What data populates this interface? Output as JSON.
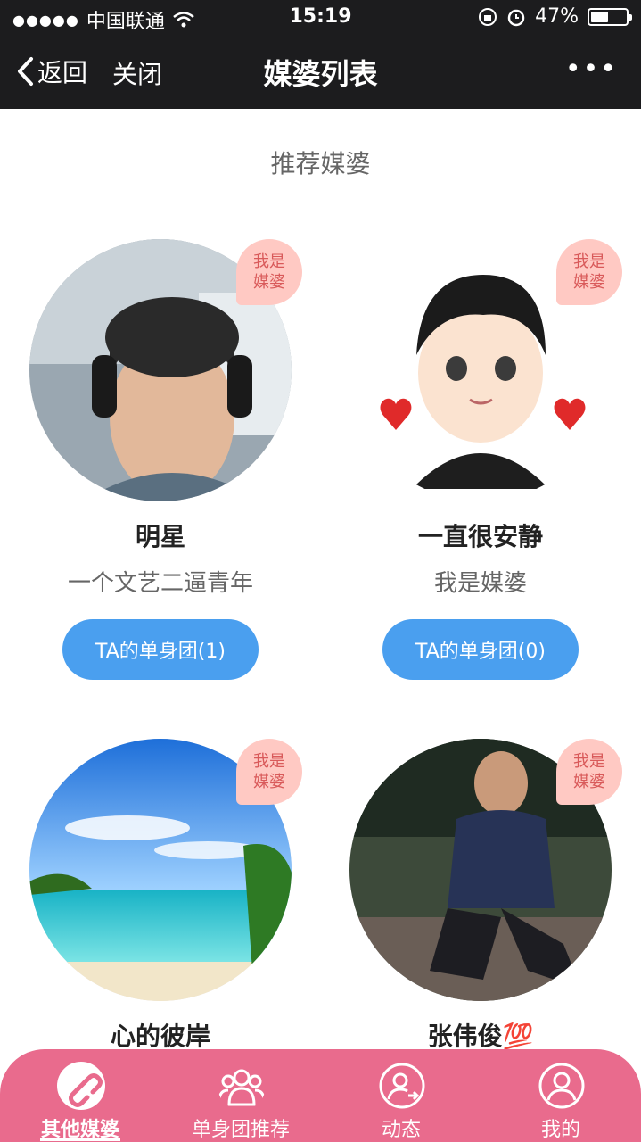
{
  "status_bar": {
    "signal": "●●●●●",
    "carrier": "中国联通",
    "time": "15:19",
    "battery": "47%"
  },
  "nav": {
    "back_label": "返回",
    "close_label": "关闭",
    "title": "媒婆列表",
    "more_label": "•••"
  },
  "section_title": "推荐媒婆",
  "tag_label": "我是\n媒婆",
  "cards": [
    {
      "name": "明星",
      "bio": "一个文艺二逼青年",
      "button": "TA的单身团(1)"
    },
    {
      "name": "一直很安静",
      "bio": "我是媒婆",
      "button": "TA的单身团(0)"
    },
    {
      "name": "心的彼岸",
      "bio": "",
      "button": ""
    },
    {
      "name": "张伟俊💯",
      "bio": "",
      "button": ""
    }
  ],
  "tabs": [
    {
      "label": "其他媒婆",
      "icon": "link-icon",
      "active": true
    },
    {
      "label": "单身团推荐",
      "icon": "group-icon",
      "active": false
    },
    {
      "label": "动态",
      "icon": "user-arrow-icon",
      "active": false
    },
    {
      "label": "我的",
      "icon": "user-icon",
      "active": false
    }
  ],
  "colors": {
    "nav_bg": "#1c1c1e",
    "accent_blue": "#4a9fef",
    "tab_pink": "#e96b8d",
    "tag_pink": "#ffc9c3"
  }
}
